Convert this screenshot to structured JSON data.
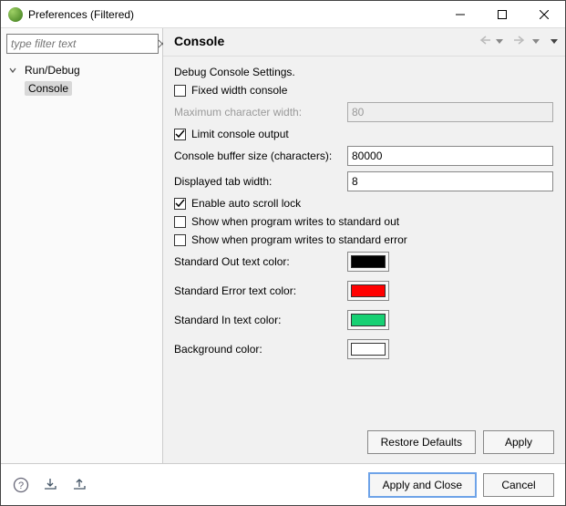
{
  "window": {
    "title": "Preferences (Filtered)"
  },
  "filter": {
    "placeholder": "type filter text"
  },
  "tree": {
    "root": "Run/Debug",
    "child": "Console"
  },
  "header": {
    "title": "Console"
  },
  "form": {
    "section": "Debug Console Settings.",
    "fixed_width": "Fixed width console",
    "max_char_width_label": "Maximum character width:",
    "max_char_width_value": "80",
    "limit_output": "Limit console output",
    "buffer_label": "Console buffer size (characters):",
    "buffer_value": "80000",
    "tab_width_label": "Displayed tab width:",
    "tab_width_value": "8",
    "auto_scroll": "Enable auto scroll lock",
    "show_stdout": "Show when program writes to standard out",
    "show_stderr": "Show when program writes to standard error",
    "stdout_color_label": "Standard Out text color:",
    "stderr_color_label": "Standard Error text color:",
    "stdin_color_label": "Standard In text color:",
    "bg_color_label": "Background color:",
    "colors": {
      "stdout": "#000000",
      "stderr": "#ff0000",
      "stdin": "#17d073",
      "background": "#ffffff"
    }
  },
  "buttons": {
    "restore_defaults": "Restore Defaults",
    "apply": "Apply",
    "apply_close": "Apply and Close",
    "cancel": "Cancel"
  }
}
